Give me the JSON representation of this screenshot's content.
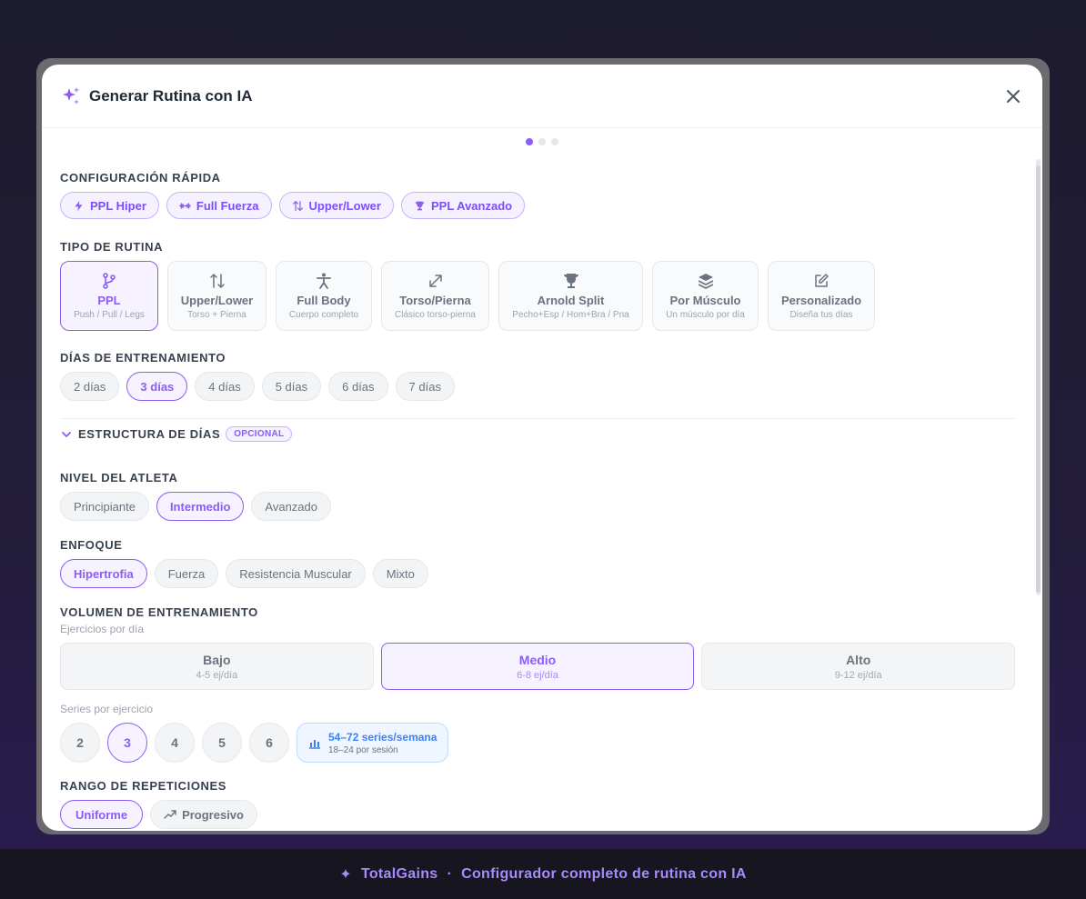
{
  "modal": {
    "title": "Generar Rutina con IA",
    "close_icon": "close-icon",
    "step_dots": [
      true,
      false,
      false
    ]
  },
  "quick_config": {
    "label": "CONFIGURACIÓN RÁPIDA",
    "chips": [
      {
        "label": "PPL Hiper",
        "icon": "bolt-icon"
      },
      {
        "label": "Full Fuerza",
        "icon": "dumbbell-icon"
      },
      {
        "label": "Upper/Lower",
        "icon": "arrows-updown-icon"
      },
      {
        "label": "PPL Avanzado",
        "icon": "trophy-icon"
      }
    ]
  },
  "routine_type": {
    "label": "TIPO DE RUTINA",
    "options": [
      {
        "title": "PPL",
        "desc": "Push / Pull / Legs",
        "icon": "git-branch-icon",
        "active": true
      },
      {
        "title": "Upper/Lower",
        "desc": "Torso + Pierna",
        "icon": "arrows-updown-icon",
        "active": false
      },
      {
        "title": "Full Body",
        "desc": "Cuerpo completo",
        "icon": "person-icon",
        "active": false
      },
      {
        "title": "Torso/Pierna",
        "desc": "Clásico torso-pierna",
        "icon": "expand-icon",
        "active": false
      },
      {
        "title": "Arnold Split",
        "desc": "Pecho+Esp / Hom+Bra / Pna",
        "icon": "trophy-icon",
        "active": false
      },
      {
        "title": "Por Músculo",
        "desc": "Un músculo por día",
        "icon": "layers-icon",
        "active": false
      },
      {
        "title": "Personalizado",
        "desc": "Diseña tus días",
        "icon": "edit-icon",
        "active": false
      }
    ]
  },
  "training_days": {
    "label": "DÍAS DE ENTRENAMIENTO",
    "options": [
      "2 días",
      "3 días",
      "4 días",
      "5 días",
      "6 días",
      "7 días"
    ],
    "selected": "3 días"
  },
  "day_structure": {
    "label": "ESTRUCTURA DE DÍAS",
    "badge": "OPCIONAL"
  },
  "athlete_level": {
    "label": "NIVEL DEL ATLETA",
    "options": [
      "Principiante",
      "Intermedio",
      "Avanzado"
    ],
    "selected": "Intermedio"
  },
  "focus": {
    "label": "ENFOQUE",
    "options": [
      "Hipertrofia",
      "Fuerza",
      "Resistencia Muscular",
      "Mixto"
    ],
    "selected": "Hipertrofia"
  },
  "volume": {
    "label": "VOLUMEN DE ENTRENAMIENTO",
    "sublabel": "Ejercicios por día",
    "options": [
      {
        "title": "Bajo",
        "desc": "4-5 ej/día",
        "active": false
      },
      {
        "title": "Medio",
        "desc": "6-8 ej/día",
        "active": true
      },
      {
        "title": "Alto",
        "desc": "9-12 ej/día",
        "active": false
      }
    ],
    "series_label": "Series por ejercicio",
    "series_options": [
      "2",
      "3",
      "4",
      "5",
      "6"
    ],
    "series_selected": "3",
    "summary_main": "54–72 series/semana",
    "summary_sub": "18–24 por sesión"
  },
  "rep_range": {
    "label": "RANGO DE REPETICIONES",
    "options": [
      {
        "label": "Uniforme",
        "active": true
      },
      {
        "label": "Progresivo",
        "icon": "trending-up-icon",
        "active": false
      }
    ]
  },
  "footer": {
    "star": "✦",
    "brand": "TotalGains",
    "separator": "·",
    "tagline": "Configurador completo de rutina con IA"
  },
  "colors": {
    "accent": "#8b5cf6",
    "accent_bg": "#f6f2ff",
    "info": "#3b82f6"
  }
}
